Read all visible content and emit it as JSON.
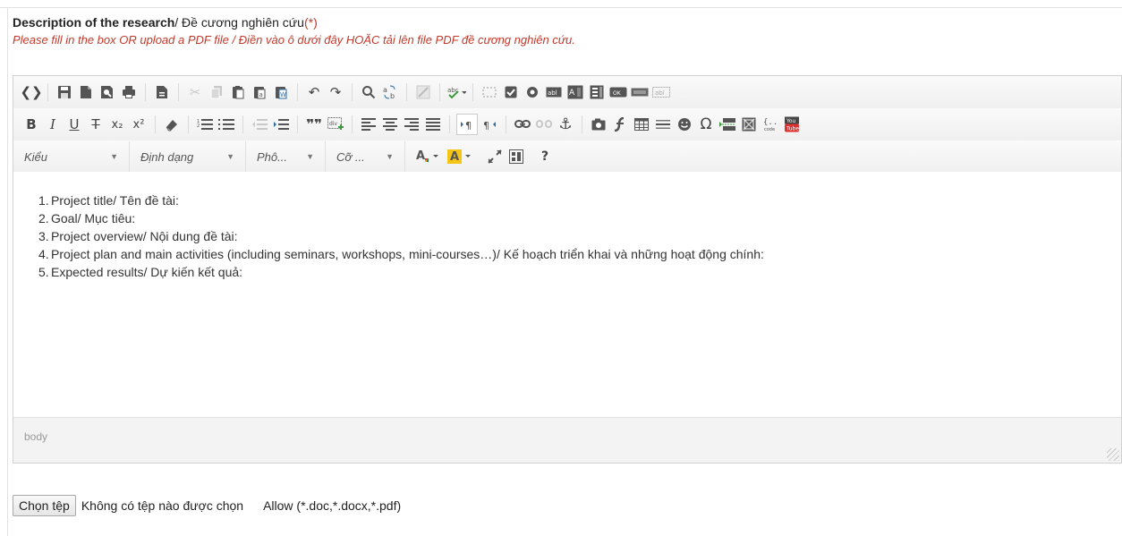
{
  "form": {
    "label_bold": "Description of the research",
    "label_rest": "/ Đề cương nghiên cứu",
    "required_mark": "(*)",
    "hint": "Please fill in the box OR upload a PDF file / Điền vào ô dưới đây HOẶC tải lên file PDF đề cương nghiên cứu."
  },
  "toolbar": {
    "style_combo": "Kiểu",
    "format_combo": "Định dạng",
    "font_combo": "Phô...",
    "size_combo": "Cỡ ...",
    "help": "?"
  },
  "content": {
    "items": [
      {
        "num": "1.",
        "text": "Project title/ Tên đề tài:"
      },
      {
        "num": "2.",
        "text": "Goal/ Mục tiêu:"
      },
      {
        "num": "3.",
        "text": "Project overview/ Nội dung đề tài:"
      },
      {
        "num": "4.",
        "text": "Project plan and main activities (including seminars, workshops, mini-courses…)/ Kế hoạch triển khai và những hoạt động chính:"
      },
      {
        "num": "5.",
        "text": "Expected results/ Dự kiến kết quả:"
      }
    ]
  },
  "statusbar": {
    "path": "body"
  },
  "file": {
    "button": "Chọn tệp",
    "status": "Không có tệp nào được chọn",
    "allow": "Allow (*.doc,*.docx,*.pdf)"
  },
  "colors": {
    "hint": "#c0392b",
    "toolbar_bg": "#f3f3f3"
  }
}
